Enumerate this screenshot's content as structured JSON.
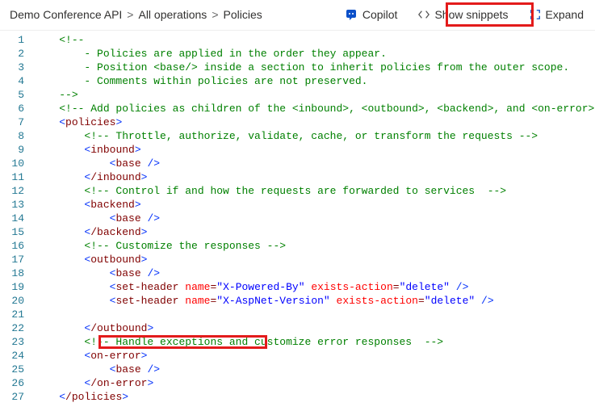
{
  "breadcrumb": {
    "api": "Demo Conference API",
    "operations": "All operations",
    "policies": "Policies"
  },
  "actions": {
    "copilot": "Copilot",
    "snippets": "Show snippets",
    "expand": "Expand"
  },
  "code": {
    "lines": [
      {
        "n": 1,
        "indent": 1,
        "kind": "comment",
        "text": "<!--"
      },
      {
        "n": 2,
        "indent": 2,
        "kind": "comment",
        "text": "- Policies are applied in the order they appear."
      },
      {
        "n": 3,
        "indent": 2,
        "kind": "comment",
        "text": "- Position <base/> inside a section to inherit policies from the outer scope."
      },
      {
        "n": 4,
        "indent": 2,
        "kind": "comment",
        "text": "- Comments within policies are not preserved."
      },
      {
        "n": 5,
        "indent": 1,
        "kind": "comment",
        "text": "-->"
      },
      {
        "n": 6,
        "indent": 1,
        "kind": "comment",
        "text": "<!-- Add policies as children of the <inbound>, <outbound>, <backend>, and <on-error> ele"
      },
      {
        "n": 7,
        "indent": 1,
        "kind": "openclose",
        "tag": "policies",
        "close": false
      },
      {
        "n": 8,
        "indent": 2,
        "kind": "comment",
        "text": "<!-- Throttle, authorize, validate, cache, or transform the requests -->"
      },
      {
        "n": 9,
        "indent": 2,
        "kind": "openclose",
        "tag": "inbound",
        "close": false
      },
      {
        "n": 10,
        "indent": 3,
        "kind": "selfclose",
        "tag": "base"
      },
      {
        "n": 11,
        "indent": 2,
        "kind": "openclose",
        "tag": "inbound",
        "close": true
      },
      {
        "n": 12,
        "indent": 2,
        "kind": "comment",
        "text": "<!-- Control if and how the requests are forwarded to services  -->"
      },
      {
        "n": 13,
        "indent": 2,
        "kind": "openclose",
        "tag": "backend",
        "close": false
      },
      {
        "n": 14,
        "indent": 3,
        "kind": "selfclose",
        "tag": "base"
      },
      {
        "n": 15,
        "indent": 2,
        "kind": "openclose",
        "tag": "backend",
        "close": true
      },
      {
        "n": 16,
        "indent": 2,
        "kind": "comment",
        "text": "<!-- Customize the responses -->"
      },
      {
        "n": 17,
        "indent": 2,
        "kind": "openclose",
        "tag": "outbound",
        "close": false
      },
      {
        "n": 18,
        "indent": 3,
        "kind": "selfclose",
        "tag": "base"
      },
      {
        "n": 19,
        "indent": 3,
        "kind": "setheader",
        "name": "X-Powered-By",
        "action": "delete"
      },
      {
        "n": 20,
        "indent": 3,
        "kind": "setheader",
        "name": "X-AspNet-Version",
        "action": "delete"
      },
      {
        "n": 21,
        "indent": 3,
        "kind": "blank"
      },
      {
        "n": 22,
        "indent": 2,
        "kind": "openclose",
        "tag": "outbound",
        "close": true
      },
      {
        "n": 23,
        "indent": 2,
        "kind": "comment",
        "text": "<!-- Handle exceptions and customize error responses  -->"
      },
      {
        "n": 24,
        "indent": 2,
        "kind": "openclose",
        "tag": "on-error",
        "close": false
      },
      {
        "n": 25,
        "indent": 3,
        "kind": "selfclose",
        "tag": "base"
      },
      {
        "n": 26,
        "indent": 2,
        "kind": "openclose",
        "tag": "on-error",
        "close": true
      },
      {
        "n": 27,
        "indent": 1,
        "kind": "openclose",
        "tag": "policies",
        "close": true
      }
    ]
  }
}
